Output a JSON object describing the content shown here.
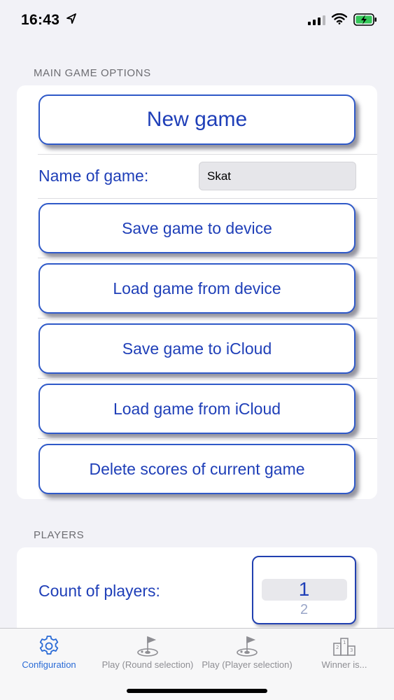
{
  "status_bar": {
    "time": "16:43"
  },
  "main_options": {
    "header": "MAIN GAME OPTIONS",
    "new_game": "New game",
    "name_label": "Name of game:",
    "name_value": "Skat",
    "save_device": "Save game to device",
    "load_device": "Load game from device",
    "save_icloud": "Save game to iCloud",
    "load_icloud": "Load game from iCloud",
    "delete_scores": "Delete scores of current game"
  },
  "players": {
    "header": "PLAYERS",
    "count_label": "Count of players:",
    "count_value": "1",
    "count_next": "2"
  },
  "tab_bar": {
    "tabs": [
      {
        "label": "Configuration",
        "icon": "gear-icon",
        "active": true
      },
      {
        "label": "Play (Round selection)",
        "icon": "golf-flag-icon",
        "active": false
      },
      {
        "label": "Play (Player selection)",
        "icon": "golf-flag-icon",
        "active": false
      },
      {
        "label": "Winner is...",
        "icon": "podium-icon",
        "active": false
      }
    ]
  },
  "colors": {
    "accent": "#1f3fb8",
    "button_border": "#2f59c8",
    "tab_active": "#2a6bd6",
    "tab_inactive": "#8e8e93",
    "background": "#f2f2f7"
  }
}
